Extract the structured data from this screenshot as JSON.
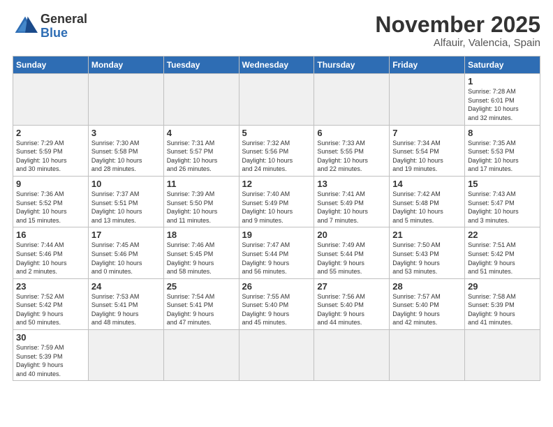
{
  "header": {
    "logo_general": "General",
    "logo_blue": "Blue",
    "month": "November 2025",
    "location": "Alfauir, Valencia, Spain"
  },
  "weekdays": [
    "Sunday",
    "Monday",
    "Tuesday",
    "Wednesday",
    "Thursday",
    "Friday",
    "Saturday"
  ],
  "weeks": [
    [
      {
        "day": "",
        "info": ""
      },
      {
        "day": "",
        "info": ""
      },
      {
        "day": "",
        "info": ""
      },
      {
        "day": "",
        "info": ""
      },
      {
        "day": "",
        "info": ""
      },
      {
        "day": "",
        "info": ""
      },
      {
        "day": "1",
        "info": "Sunrise: 7:28 AM\nSunset: 6:01 PM\nDaylight: 10 hours\nand 32 minutes."
      }
    ],
    [
      {
        "day": "2",
        "info": "Sunrise: 7:29 AM\nSunset: 5:59 PM\nDaylight: 10 hours\nand 30 minutes."
      },
      {
        "day": "3",
        "info": "Sunrise: 7:30 AM\nSunset: 5:58 PM\nDaylight: 10 hours\nand 28 minutes."
      },
      {
        "day": "4",
        "info": "Sunrise: 7:31 AM\nSunset: 5:57 PM\nDaylight: 10 hours\nand 26 minutes."
      },
      {
        "day": "5",
        "info": "Sunrise: 7:32 AM\nSunset: 5:56 PM\nDaylight: 10 hours\nand 24 minutes."
      },
      {
        "day": "6",
        "info": "Sunrise: 7:33 AM\nSunset: 5:55 PM\nDaylight: 10 hours\nand 22 minutes."
      },
      {
        "day": "7",
        "info": "Sunrise: 7:34 AM\nSunset: 5:54 PM\nDaylight: 10 hours\nand 19 minutes."
      },
      {
        "day": "8",
        "info": "Sunrise: 7:35 AM\nSunset: 5:53 PM\nDaylight: 10 hours\nand 17 minutes."
      }
    ],
    [
      {
        "day": "9",
        "info": "Sunrise: 7:36 AM\nSunset: 5:52 PM\nDaylight: 10 hours\nand 15 minutes."
      },
      {
        "day": "10",
        "info": "Sunrise: 7:37 AM\nSunset: 5:51 PM\nDaylight: 10 hours\nand 13 minutes."
      },
      {
        "day": "11",
        "info": "Sunrise: 7:39 AM\nSunset: 5:50 PM\nDaylight: 10 hours\nand 11 minutes."
      },
      {
        "day": "12",
        "info": "Sunrise: 7:40 AM\nSunset: 5:49 PM\nDaylight: 10 hours\nand 9 minutes."
      },
      {
        "day": "13",
        "info": "Sunrise: 7:41 AM\nSunset: 5:49 PM\nDaylight: 10 hours\nand 7 minutes."
      },
      {
        "day": "14",
        "info": "Sunrise: 7:42 AM\nSunset: 5:48 PM\nDaylight: 10 hours\nand 5 minutes."
      },
      {
        "day": "15",
        "info": "Sunrise: 7:43 AM\nSunset: 5:47 PM\nDaylight: 10 hours\nand 3 minutes."
      }
    ],
    [
      {
        "day": "16",
        "info": "Sunrise: 7:44 AM\nSunset: 5:46 PM\nDaylight: 10 hours\nand 2 minutes."
      },
      {
        "day": "17",
        "info": "Sunrise: 7:45 AM\nSunset: 5:46 PM\nDaylight: 10 hours\nand 0 minutes."
      },
      {
        "day": "18",
        "info": "Sunrise: 7:46 AM\nSunset: 5:45 PM\nDaylight: 9 hours\nand 58 minutes."
      },
      {
        "day": "19",
        "info": "Sunrise: 7:47 AM\nSunset: 5:44 PM\nDaylight: 9 hours\nand 56 minutes."
      },
      {
        "day": "20",
        "info": "Sunrise: 7:49 AM\nSunset: 5:44 PM\nDaylight: 9 hours\nand 55 minutes."
      },
      {
        "day": "21",
        "info": "Sunrise: 7:50 AM\nSunset: 5:43 PM\nDaylight: 9 hours\nand 53 minutes."
      },
      {
        "day": "22",
        "info": "Sunrise: 7:51 AM\nSunset: 5:42 PM\nDaylight: 9 hours\nand 51 minutes."
      }
    ],
    [
      {
        "day": "23",
        "info": "Sunrise: 7:52 AM\nSunset: 5:42 PM\nDaylight: 9 hours\nand 50 minutes."
      },
      {
        "day": "24",
        "info": "Sunrise: 7:53 AM\nSunset: 5:41 PM\nDaylight: 9 hours\nand 48 minutes."
      },
      {
        "day": "25",
        "info": "Sunrise: 7:54 AM\nSunset: 5:41 PM\nDaylight: 9 hours\nand 47 minutes."
      },
      {
        "day": "26",
        "info": "Sunrise: 7:55 AM\nSunset: 5:40 PM\nDaylight: 9 hours\nand 45 minutes."
      },
      {
        "day": "27",
        "info": "Sunrise: 7:56 AM\nSunset: 5:40 PM\nDaylight: 9 hours\nand 44 minutes."
      },
      {
        "day": "28",
        "info": "Sunrise: 7:57 AM\nSunset: 5:40 PM\nDaylight: 9 hours\nand 42 minutes."
      },
      {
        "day": "29",
        "info": "Sunrise: 7:58 AM\nSunset: 5:39 PM\nDaylight: 9 hours\nand 41 minutes."
      }
    ],
    [
      {
        "day": "30",
        "info": "Sunrise: 7:59 AM\nSunset: 5:39 PM\nDaylight: 9 hours\nand 40 minutes."
      },
      {
        "day": "",
        "info": ""
      },
      {
        "day": "",
        "info": ""
      },
      {
        "day": "",
        "info": ""
      },
      {
        "day": "",
        "info": ""
      },
      {
        "day": "",
        "info": ""
      },
      {
        "day": "",
        "info": ""
      }
    ]
  ]
}
